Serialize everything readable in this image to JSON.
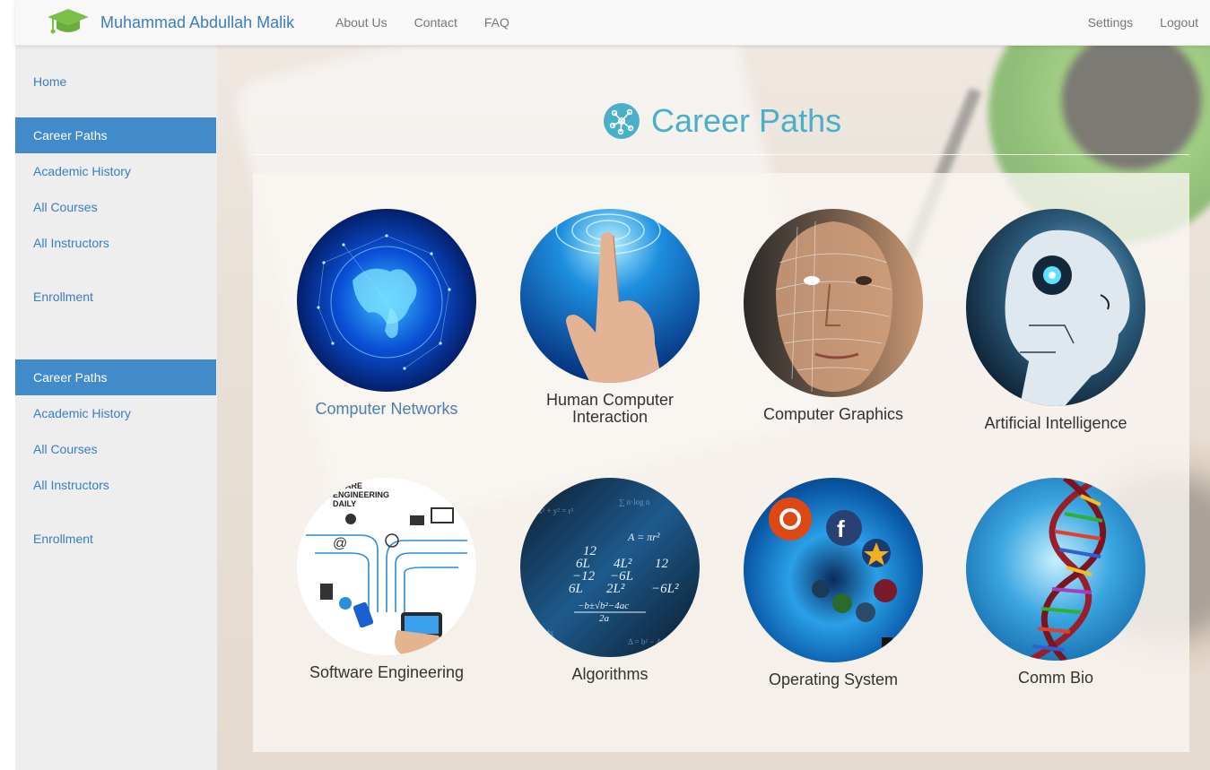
{
  "navbar": {
    "brand": "Muhammad Abdullah Malik",
    "links": [
      "About Us",
      "Contact",
      "FAQ"
    ],
    "right_links": [
      "Settings",
      "Logout"
    ]
  },
  "sidebar": {
    "items": [
      {
        "label": "Home",
        "active": false
      },
      {
        "label": "Career Paths",
        "active": true
      },
      {
        "label": "Academic History",
        "active": false
      },
      {
        "label": "All Courses",
        "active": false
      },
      {
        "label": "All Instructors",
        "active": false
      },
      {
        "label": "Enrollment",
        "active": false
      },
      {
        "label": "Career Paths",
        "active": true
      },
      {
        "label": "Academic History",
        "active": false
      },
      {
        "label": "All Courses",
        "active": false
      },
      {
        "label": "All Instructors",
        "active": false
      },
      {
        "label": "Enrollment",
        "active": false
      }
    ]
  },
  "main": {
    "title": "Career Paths",
    "title_color": "#4ab0c8",
    "cards": [
      {
        "label": "Computer Networks",
        "image": "globe-network-image"
      },
      {
        "label": "Human Computer Interaction",
        "image": "touch-hand-image"
      },
      {
        "label": "Computer Graphics",
        "image": "wireframe-face-image"
      },
      {
        "label": "Artificial Intelligence",
        "image": "robot-head-image"
      },
      {
        "label": "Software Engineering",
        "image": "software-diagram-image"
      },
      {
        "label": "Algorithms",
        "image": "math-formulas-image"
      },
      {
        "label": "Operating System",
        "image": "os-logos-image"
      },
      {
        "label": "Comm Bio",
        "image": "dna-helix-image"
      }
    ],
    "image_texts": {
      "software": [
        "WARE",
        "ENGINEERING",
        "DAILY"
      ],
      "algorithms": [
        "12",
        "6L",
        "4L²",
        "−12",
        "−6L",
        "6L",
        "2L²",
        "12",
        "−6L²",
        "A = πr²",
        "−b±√b²−4ac",
        "2a"
      ]
    }
  },
  "colors": {
    "brand": "#3b7ec0",
    "sidebar_active": "#428bca",
    "sidebar_link": "#3a7dc1",
    "nav_link": "#777777"
  }
}
